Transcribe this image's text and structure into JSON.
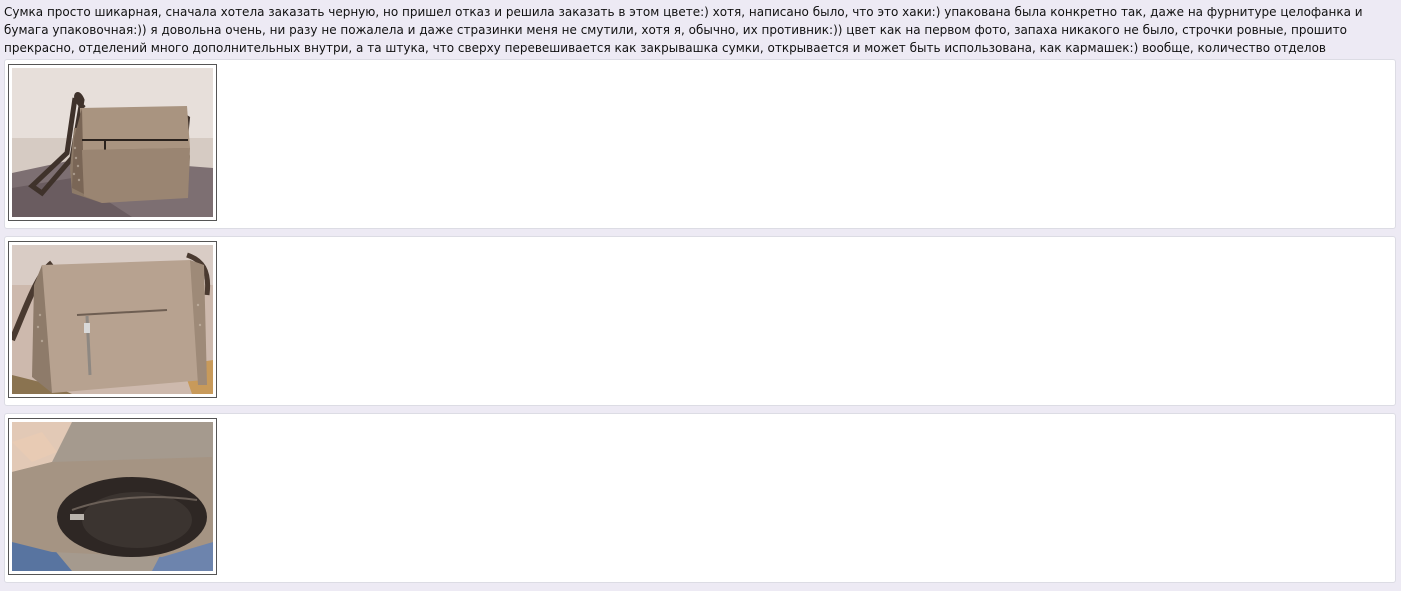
{
  "review": {
    "text": "Сумка просто шикарная, сначала хотела заказать черную, но пришел отказ и решила заказать в этом цвете:) хотя, написано было, что это хаки:) упакована была конкретно так, даже на фурнитуре целофанка и бумага упаковочная:)) я довольна очень, ни разу не пожалела и даже стразинки меня не смутили, хотя я, обычно, их противник:)) цвет как на первом фото, запаха никакого не было, строчки ровные, прошито прекрасно, отделений много дополнительных внутри, а та штука, что сверху перевешивается как закрывашка сумки, открывается и может быть использована, как кармашек:) вообще, количество отделов впечатляет:))"
  },
  "colors": {
    "page_background": "#edeaf4",
    "card_background": "#ffffff",
    "bag_taupe": "#a99480",
    "bag_dark_strap": "#4a3a30"
  },
  "photos": [
    {
      "subject": "bag-front-closed"
    },
    {
      "subject": "bag-back-zipper-pocket"
    },
    {
      "subject": "bag-open-interior"
    }
  ]
}
